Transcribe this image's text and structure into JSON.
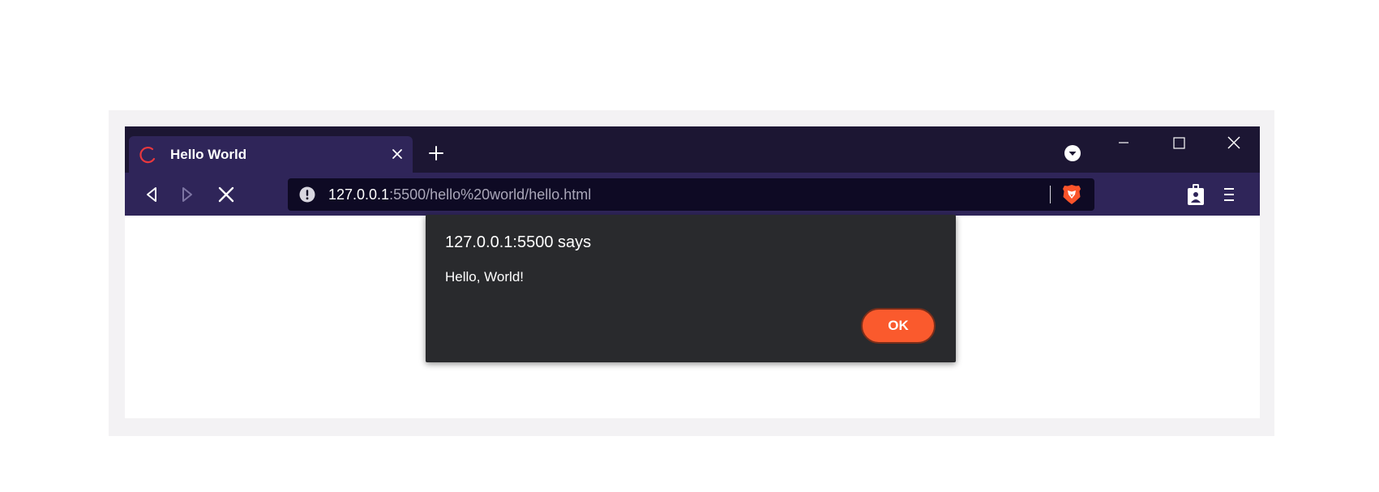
{
  "tab": {
    "title": "Hello World",
    "loading_icon": "loading-spinner-icon",
    "close_icon": "close-icon"
  },
  "tabstrip": {
    "new_tab_icon": "plus-icon",
    "tab_search_icon": "chevron-down-circle-icon"
  },
  "window_controls": {
    "minimize_icon": "minimize-icon",
    "maximize_icon": "maximize-icon",
    "close_icon": "close-icon"
  },
  "toolbar": {
    "back_icon": "back-arrow-icon",
    "forward_icon": "forward-arrow-icon",
    "stop_icon": "stop-icon"
  },
  "address": {
    "host": "127.0.0.1",
    "rest": ":5500/hello%20world/hello.html",
    "security_icon": "info-icon",
    "brave_icon": "brave-shields-icon"
  },
  "extensions": {
    "wallet_icon": "wallet-icon",
    "menu_icon": "hamburger-menu-icon"
  },
  "dialog": {
    "title": "127.0.0.1:5500 says",
    "message": "Hello, World!",
    "ok_label": "OK"
  },
  "colors": {
    "tabstrip_bg": "#1c1633",
    "toolbar_bg": "#2f2559",
    "urlbar_bg": "#0e0a24",
    "dialog_bg": "#292a2d",
    "accent": "#fa5a2d",
    "loading_red": "#e8383d"
  }
}
